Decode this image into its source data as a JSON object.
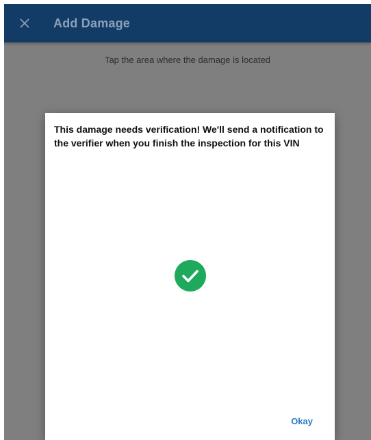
{
  "appbar": {
    "title": "Add Damage",
    "close_icon": "close-icon",
    "background_color": "#123b66"
  },
  "main": {
    "instruction": "Tap the area where the damage is located"
  },
  "dialog": {
    "message": "This damage needs verification! We'll send a notification to the verifier when you finish the inspection for this VIN",
    "status_icon": "check-circle-icon",
    "status_color": "#1eaa5d",
    "okay_label": "Okay",
    "accent_color": "#2a7cc7"
  }
}
